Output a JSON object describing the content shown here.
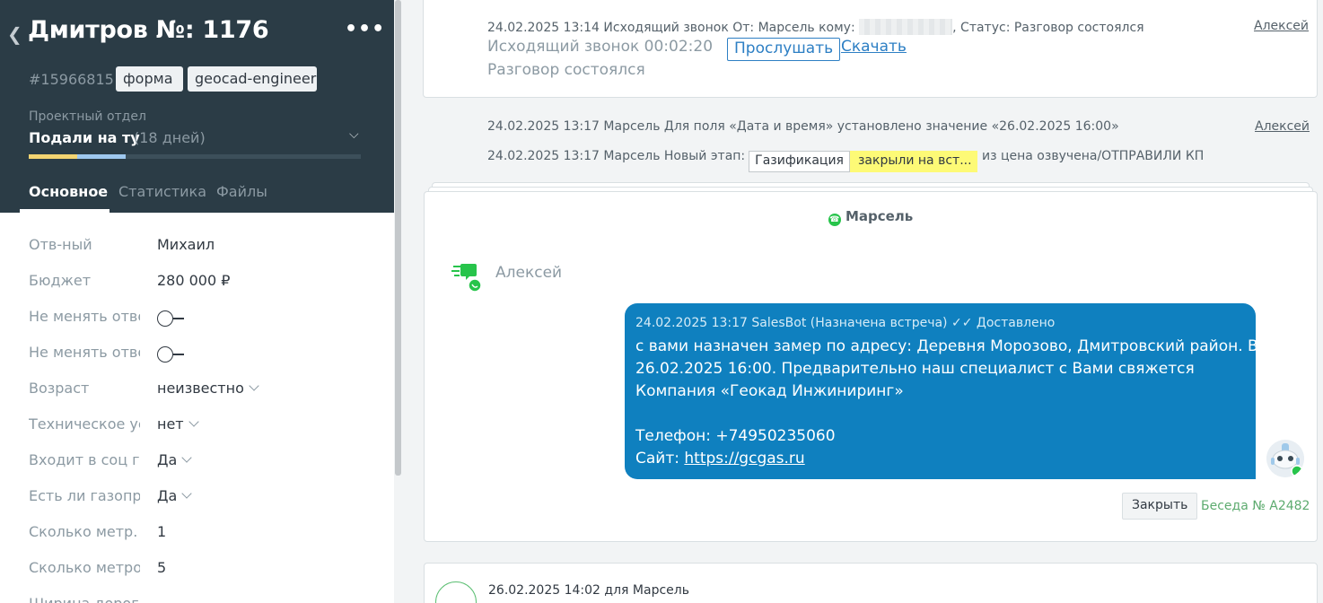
{
  "lead": {
    "back_icon": "chevron-left",
    "title": "Дмитров №: 1176",
    "more_label": "•••",
    "id": "#15966815",
    "tags": [
      "форма",
      "geocad-engineering"
    ],
    "pipeline": "Проектный отдел",
    "stage": "Подали на ту",
    "stage_days": "(18 дней)",
    "stage_progress": [
      {
        "fraction": 0.145,
        "color": "#f3d471"
      },
      {
        "fraction": 0.145,
        "color": "#9ec8ef"
      }
    ],
    "tabs": [
      "Основное",
      "Статистика",
      "Файлы"
    ],
    "active_tab": "Основное"
  },
  "fields": [
    {
      "label": "Отв-ный",
      "value": "Михаил",
      "kind": "text"
    },
    {
      "label": "Бюджет",
      "value": "280 000  ₽",
      "kind": "text"
    },
    {
      "label": "Не менять ответственного",
      "value": "",
      "kind": "toggle"
    },
    {
      "label": "Не менять ответственного",
      "value": "",
      "kind": "toggle"
    },
    {
      "label": "Возраст",
      "value": "неизвестно",
      "kind": "select"
    },
    {
      "label": "Техническое условие",
      "value": "нет",
      "kind": "select"
    },
    {
      "label": "Входит в соц газификацию",
      "value": "Да",
      "kind": "select"
    },
    {
      "label": "Есть ли газопровод",
      "value": "Да",
      "kind": "select"
    },
    {
      "label": "Сколько метр. от",
      "value": "1",
      "kind": "text"
    },
    {
      "label": "Сколько метров",
      "value": "5",
      "kind": "text"
    },
    {
      "label": "Ширина дороги",
      "value": "",
      "kind": "text"
    }
  ],
  "feed": {
    "call": {
      "meta_prefix": "24.02.2025 13:14 Исходящий звонок От: Марсель кому:",
      "meta_suffix": ", Статус: Разговор состоялся",
      "author": "Алексей",
      "line2": "Исходящий звонок 00:02:20",
      "listen_label": "Прослушать",
      "download_label": "Скачать",
      "line3": "Разговор состоялся"
    },
    "event1": {
      "text": "24.02.2025 13:17 Марсель Для поля «Дата и время» установлено значение «26.02.2025 16:00»",
      "author": "Алексей"
    },
    "event2": {
      "prefix": "24.02.2025 13:17 Марсель Новый этап:",
      "stage_from": "Газификация",
      "stage_to": "закрыли на вст...",
      "suffix": "из цена озвучена/ОТПРАВИЛИ КП"
    },
    "chat": {
      "contact": "Марсель",
      "sender": "Алексей",
      "message_meta": "24.02.2025 13:17 SalesBot (Назначена встреча)",
      "status": "Доставлено",
      "lines": [
        "с вами назначен замер по адресу: Деревня Морозово, Дмитровский район. Время",
        "26.02.2025 16:00. Предварительно наш специалист с Вами свяжется",
        "Компания «Геокад Инжиниринг»",
        "",
        "Телефон: +74950235060"
      ],
      "site_prefix": "Сайт: ",
      "site_link": "https://gcgas.ru",
      "close_label": "Закрыть",
      "conversation_link": "Беседа № А2482"
    },
    "task": {
      "meta": "26.02.2025 14:02  для Марсель"
    }
  },
  "colors": {
    "header_bg": "#2b3c46",
    "bubble_bg": "#0f80bf",
    "link_blue": "#2d7fc4",
    "whatsapp_green": "#27c44b",
    "highlight_yellow": "#fdfa76"
  }
}
